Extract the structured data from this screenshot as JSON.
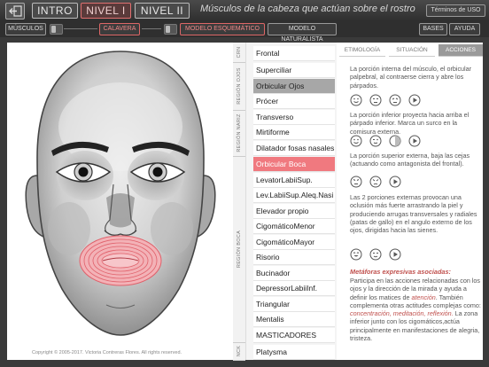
{
  "header": {
    "nav": [
      "INTRO",
      "NIVEL I",
      "NIVEL II"
    ],
    "title": "Músculos de la cabeza que actúan sobre el rostro",
    "terms_label": "Términos de USO"
  },
  "toolbar": {
    "muscles_label": "MÚSCULOS",
    "skull_label": "CALAVERA",
    "schematic_label": "MODELO ESQUEMÁTICO",
    "naturalist_label": "MODELO NATURALISTA",
    "bases_label": "BASES",
    "help_label": "AYUDA"
  },
  "regions": [
    "CRN",
    "REGIÓN OJOS",
    "REGIÓN NARIZ",
    "REGIÓN BOCA",
    "NCK"
  ],
  "muscles": [
    "Frontal",
    "Superciliar",
    "Orbicular Ojos",
    "Prócer",
    "Transverso",
    "Mirtiforme",
    "Dilatador fosas nasales",
    "Orbicular Boca",
    "LevatorLabiiSup.",
    "Lev.LabiiSup.Aleq.Nasi",
    "Elevador propio",
    "CigomáticoMenor",
    "CigomáticoMayor",
    "Risorio",
    "Bucinador",
    "DepressorLabiiInf.",
    "Triangular",
    "Mentalis",
    "MASTICADORES",
    "Platysma"
  ],
  "tabs": [
    "ETIMOLOGÍA",
    "SITUACIÓN",
    "ACCIONES"
  ],
  "actions": {
    "p1": "La porción interna del músculo, el orbicular palpebral, al contraerse cierra y abre los párpados.",
    "p2": "La porción inferior proyecta hacia arriba el párpado inferior. Marca un surco en la comisura externa.",
    "p3": "La porción superior externa, baja las cejas (actuando como antagonista del frontal).",
    "p4": "Las 2 porciones externas provocan una oclusión más fuerte arrastrando la piel y produciendo arrugas transversales y radiales (patas de gallo) en el angulo externo de los ojos, dirigidas hacia las sienes.",
    "meta_title": "Metáforas expresivas asociadas:",
    "meta_p1": "Participa en las acciones relacionadas con los ojos y la dirección de la mirada y ayuda a definir los matices de",
    "meta_em1": "atención",
    "meta_p2": ". También complementa otras actitudes complejas como:",
    "meta_em2": "concentración, meditación, reflexión.",
    "meta_p3": "La zona inferior junto con los cigomáticos,actúa principalmente en manifestaciones de alegria, tristeza."
  },
  "copyright": "Copyright © 2005-2017. Victoria Contreras Flores. All rights reserved.",
  "colors": {
    "accent": "#f0797f",
    "selected_grey": "#a7a7a7",
    "metaphor": "#c0504d"
  }
}
